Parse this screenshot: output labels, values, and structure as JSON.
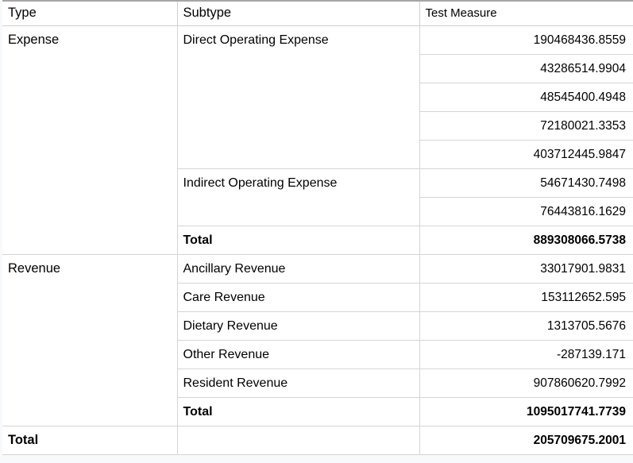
{
  "table": {
    "columns": [
      {
        "key": "type",
        "label": "Type"
      },
      {
        "key": "subtype",
        "label": "Subtype"
      },
      {
        "key": "measure",
        "label": "Test Measure"
      }
    ],
    "groups": [
      {
        "type": "Expense",
        "subgroups": [
          {
            "subtype": "Direct Operating Expense",
            "values": [
              "190468436.8559",
              "43286514.9904",
              "48545400.4948",
              "72180021.3353",
              "403712445.9847"
            ]
          },
          {
            "subtype": "Indirect Operating Expense",
            "values": [
              "54671430.7498",
              "76443816.1629"
            ]
          }
        ],
        "total_label": "Total",
        "total_value": "889308066.5738"
      },
      {
        "type": "Revenue",
        "subgroups": [
          {
            "subtype": "Ancillary Revenue",
            "values": [
              "33017901.9831"
            ]
          },
          {
            "subtype": "Care Revenue",
            "values": [
              "153112652.595"
            ]
          },
          {
            "subtype": "Dietary Revenue",
            "values": [
              "1313705.5676"
            ]
          },
          {
            "subtype": "Other Revenue",
            "values": [
              "-287139.171"
            ]
          },
          {
            "subtype": "Resident Revenue",
            "values": [
              "907860620.7992"
            ]
          }
        ],
        "total_label": "Total",
        "total_value": "1095017741.7739"
      }
    ],
    "grand_total": {
      "label": "Total",
      "subtype": "",
      "value": "205709675.2001"
    }
  }
}
